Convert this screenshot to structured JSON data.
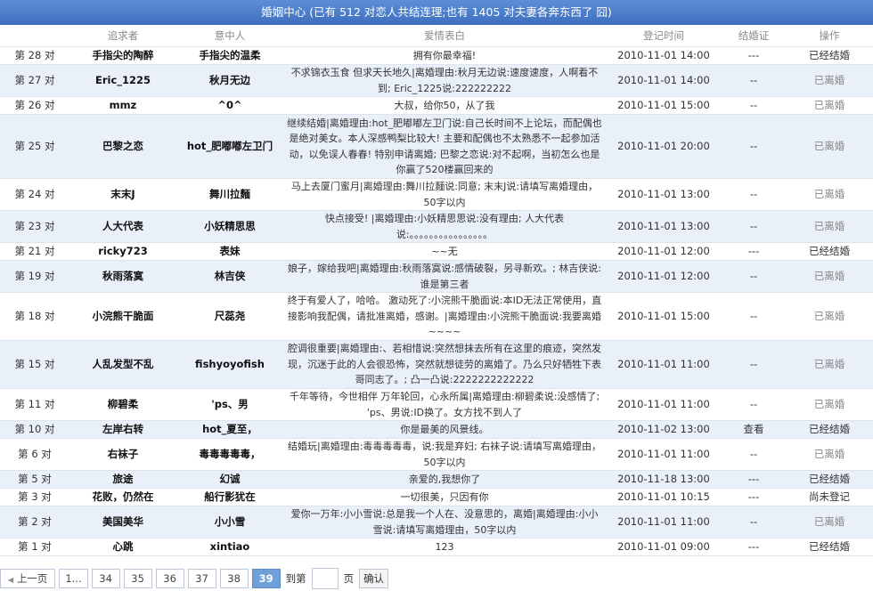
{
  "header": {
    "title": "婚姻中心 (已有 512 对恋人共结连理;也有 1405 对夫妻各奔东西了 囧)"
  },
  "columns": [
    "",
    "追求者",
    "意中人",
    "爱情表白",
    "登记时间",
    "结婚证",
    "操作"
  ],
  "rows": [
    {
      "pair": "第 28 对",
      "suitor": "手指尖的陶醉",
      "beloved": "手指尖的温柔",
      "message": "拥有你最幸福!",
      "date": "2010-11-01 14:00",
      "cert": "---",
      "op": "已经结婚",
      "status": "married"
    },
    {
      "pair": "第 27 对",
      "suitor": "Eric_1225",
      "beloved": "秋月无边",
      "message": "不求锦衣玉食 但求天长地久|离婚理由:秋月无边说:速度速度，人啊看不到; Eric_1225说:222222222",
      "date": "2010-11-01 14:00",
      "cert": "--",
      "op": "已离婚",
      "status": "divorced"
    },
    {
      "pair": "第 26 对",
      "suitor": "mmz",
      "beloved": "^0^",
      "message": "大叔，给你50，从了我",
      "date": "2010-11-01 15:00",
      "cert": "--",
      "op": "已离婚",
      "status": "divorced"
    },
    {
      "pair": "第 25 对",
      "suitor": "巴黎之恋",
      "beloved": "hot_肥嘟嘟左卫门",
      "message": "继续结婚|离婚理由:hot_肥嘟嘟左卫门说:自己长时间不上论坛，而配偶也是绝对美女。本人深感鸭梨比较大! 主要和配偶也不太熟悉不一起参加活动，以免误人春春! 特别申请离婚; 巴黎之恋说:对不起啊，当初怎么也是你赢了520楼赢回来的",
      "date": "2010-11-01 20:00",
      "cert": "--",
      "op": "已离婚",
      "status": "divorced"
    },
    {
      "pair": "第 24 对",
      "suitor": "末末J",
      "beloved": "舞川拉麵",
      "message": "马上去厦门蜜月|离婚理由:舞川拉麵说:同意; 末末J说:请填写离婚理由，50字以内",
      "date": "2010-11-01 13:00",
      "cert": "--",
      "op": "已离婚",
      "status": "divorced"
    },
    {
      "pair": "第 23 对",
      "suitor": "人大代表",
      "beloved": "小妖精思思",
      "message": "快点接受! |离婚理由:小妖精思思说:没有理由; 人大代表说:。。。。。。。。。。。。。。。。",
      "date": "2010-11-01 13:00",
      "cert": "--",
      "op": "已离婚",
      "status": "divorced"
    },
    {
      "pair": "第 21 对",
      "suitor": "ricky723",
      "beloved": "表妹",
      "message": "~~无",
      "date": "2010-11-01 12:00",
      "cert": "---",
      "op": "已经结婚",
      "status": "married"
    },
    {
      "pair": "第 19 对",
      "suitor": "秋雨落寞",
      "beloved": "林吉侠",
      "message": "娘子，嫁给我吧|离婚理由:秋雨落寞说:感情破裂，另寻新欢。; 林吉侠说:谁是第三者",
      "date": "2010-11-01 12:00",
      "cert": "--",
      "op": "已离婚",
      "status": "divorced"
    },
    {
      "pair": "第 18 对",
      "suitor": "小浣熊干脆面",
      "beloved": "尺蕊尧",
      "message": "终于有爱人了，哈哈。 激动死了:小浣熊干脆面说:本ID无法正常使用，直接影响我配偶，请批准离婚，感谢。|离婚理由:小浣熊干脆面说:我要离婚~~~~",
      "date": "2010-11-01 15:00",
      "cert": "--",
      "op": "已离婚",
      "status": "divorced"
    },
    {
      "pair": "第 15 对",
      "suitor": "人乱发型不乱",
      "beloved": "fishyoyofish",
      "message": "腔调很重要|离婚理由:、若相惜说:突然想抹去所有在这里的痕迹，突然发现，沉迷于此的人会很恐怖，突然就想徒劳的离婚了。乃么只好牺牲下表哥同志了。; 凸一凸说:2222222222222",
      "date": "2010-11-01 11:00",
      "cert": "--",
      "op": "已离婚",
      "status": "divorced"
    },
    {
      "pair": "第 11 对",
      "suitor": "柳碧柔",
      "beloved": "'ps、男",
      "message": "千年等待，今世相伴 万年轮回，心永所属|离婚理由:柳碧柔说:没感情了; 'ps、男说:ID换了。女方找不到人了",
      "date": "2010-11-01 11:00",
      "cert": "--",
      "op": "已离婚",
      "status": "divorced"
    },
    {
      "pair": "第 10 对",
      "suitor": "左岸右转",
      "beloved": "hot_夏至，",
      "message": "你是最美的风景线。",
      "date": "2010-11-02 13:00",
      "cert": "查看",
      "op": "已经结婚",
      "status": "married"
    },
    {
      "pair": "第 6 对",
      "suitor": "右袜子",
      "beloved": "毒毒毒毒毒，",
      "message": "结婚玩|离婚理由:毒毒毒毒毒，说:我是弃妇; 右袜子说:请填写离婚理由，50字以内",
      "date": "2010-11-01 11:00",
      "cert": "--",
      "op": "已离婚",
      "status": "divorced"
    },
    {
      "pair": "第 5 对",
      "suitor": "旅途",
      "beloved": "幻诚",
      "message": "亲爱的,我想你了",
      "date": "2010-11-18 13:00",
      "cert": "---",
      "op": "已经结婚",
      "status": "married"
    },
    {
      "pair": "第 3 对",
      "suitor": "花败，仍然在",
      "beloved": "船行影犹在",
      "message": "一切很美，只因有你",
      "date": "2010-11-01 10:15",
      "cert": "---",
      "op": "尚未登记",
      "status": "pending"
    },
    {
      "pair": "第 2 对",
      "suitor": "美国美华",
      "beloved": "小小雪",
      "message": "爱你一万年:小小雪说:总是我一个人在、没意思的，离婚|离婚理由:小小雪说:请填写离婚理由，50字以内",
      "date": "2010-11-01 11:00",
      "cert": "--",
      "op": "已离婚",
      "status": "divorced"
    },
    {
      "pair": "第 1 对",
      "suitor": "心跳",
      "beloved": "xintiao",
      "message": "123",
      "date": "2010-11-01 09:00",
      "cert": "---",
      "op": "已经结婚",
      "status": "married"
    }
  ],
  "pager": {
    "prev": "上一页",
    "first": "1...",
    "pages": [
      "34",
      "35",
      "36",
      "37",
      "38"
    ],
    "current": "39",
    "goto_label": "到第",
    "page_label": "页",
    "confirm": "确认"
  }
}
